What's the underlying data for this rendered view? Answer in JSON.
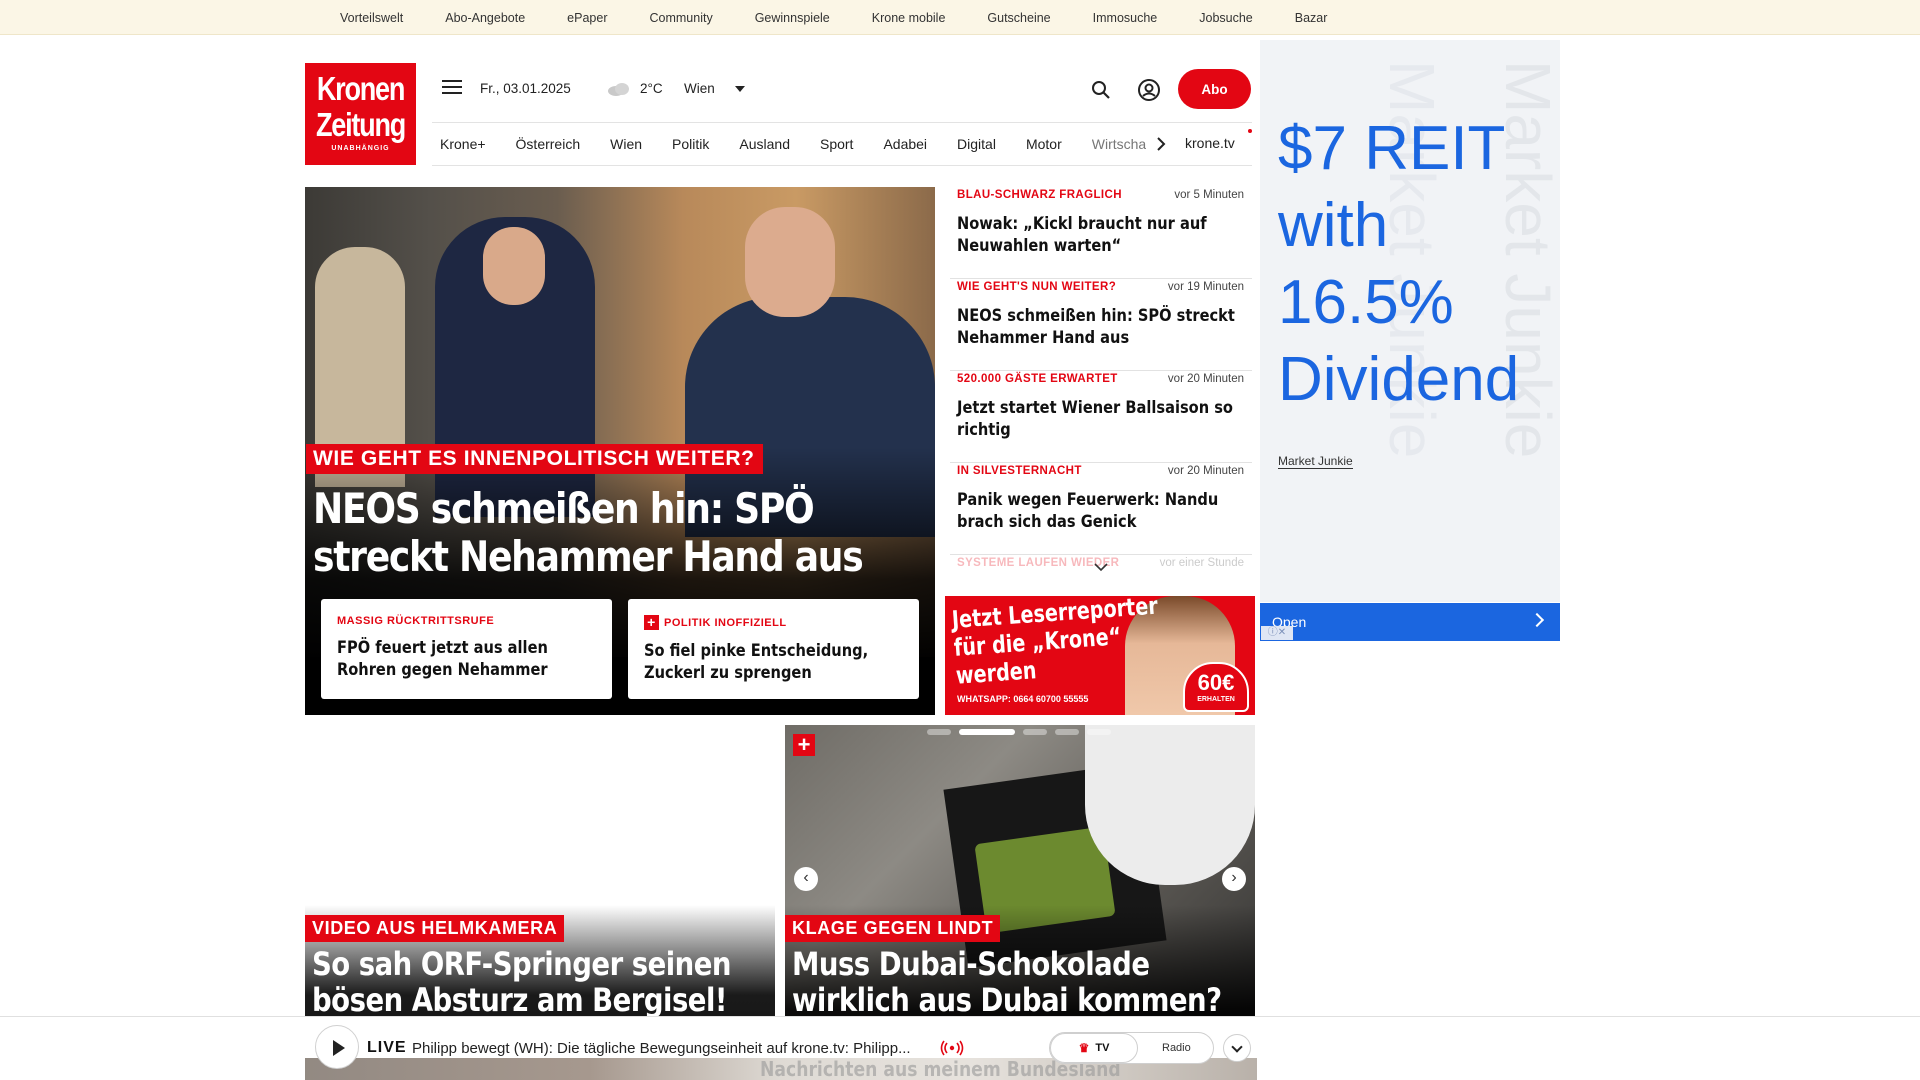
{
  "topbar": {
    "links": [
      "Vorteilswelt",
      "Abo-Angebote",
      "ePaper",
      "Community",
      "Gewinnspiele",
      "Krone mobile",
      "Gutscheine",
      "Immosuche",
      "Jobsuche",
      "Bazar"
    ]
  },
  "logo": {
    "line1": "Kronen",
    "line2": "Zeitung",
    "line3": "UNABHÄNGIG"
  },
  "header": {
    "date": "Fr., 03.01.2025",
    "temperature": "2°C",
    "city": "Wien",
    "abo_label": "Abo"
  },
  "nav": {
    "items": [
      "Krone+",
      "Österreich",
      "Wien",
      "Politik",
      "Ausland",
      "Sport",
      "Adabei",
      "Digital",
      "Motor",
      "Wirtschaft"
    ],
    "tv_label": "krone.tv"
  },
  "hero": {
    "kicker": "WIE GEHT ES INNENPOLITISCH WEITER?",
    "title": "NEOS schmeißen hin: SPÖ streckt Nehammer Hand aus",
    "cards": [
      {
        "kicker": "MASSIG RÜCKTRITTSRUFE",
        "title": "FPÖ feuert jetzt aus allen Rohren gegen Nehammer"
      },
      {
        "kicker": "POLITIK INOFFIZIELL",
        "title": "So fiel pinke Entscheidung, Zuckerl zu sprengen"
      }
    ]
  },
  "side_news": [
    {
      "kicker": "BLAU-SCHWARZ FRAGLICH",
      "time": "vor 5 Minuten",
      "title": "Nowak: „Kickl braucht nur auf Neuwahlen warten“"
    },
    {
      "kicker": "WIE GEHT'S NUN WEITER?",
      "time": "vor 19 Minuten",
      "title": "NEOS schmeißen hin: SPÖ streckt Nehammer Hand aus"
    },
    {
      "kicker": "520.000 GÄSTE ERWARTET",
      "time": "vor 20 Minuten",
      "title": "Jetzt startet Wiener Ballsaison so richtig"
    },
    {
      "kicker": "IN SILVESTERNACHT",
      "time": "vor 20 Minuten",
      "title": "Panik wegen Feuerwerk: Nandu brach sich das Genick"
    },
    {
      "kicker": "SYSTEME LAUFEN WIEDER",
      "time": "vor einer Stunde",
      "title": ""
    }
  ],
  "leser_ad": {
    "headline": "Jetzt Leserreporter für die „Krone“ werden",
    "whatsapp": "WHATSAPP: 0664 60700 55555",
    "amount": "60€",
    "amount_note": "ERHALTEN"
  },
  "right_ad": {
    "headline": "$7 REIT with 16.5% Dividend",
    "brand": "Market Junkie",
    "watermark": "Market Junkie",
    "cta": "Open"
  },
  "stories": [
    {
      "kicker": "VIDEO AUS HELMKAMERA",
      "title": "So sah ORF-Springer seinen bösen Absturz am Bergisel!"
    },
    {
      "kicker": "KLAGE GEGEN LINDT",
      "title": "Muss Dubai-Schokolade wirklich aus Dubai kommen?"
    }
  ],
  "livebar": {
    "live_label": "LIVE",
    "text": "Philipp bewegt (WH): Die tägliche Bewegungseinheit auf krone.tv: Philipp...",
    "tv_label": "TV",
    "radio_label": "Radio",
    "behind_text": "Nachrichten aus meinem Bundesland"
  },
  "colors": {
    "brand_red": "#e30613",
    "ad_blue": "#1b66e0",
    "topbar_bg": "#fbf6e6"
  }
}
